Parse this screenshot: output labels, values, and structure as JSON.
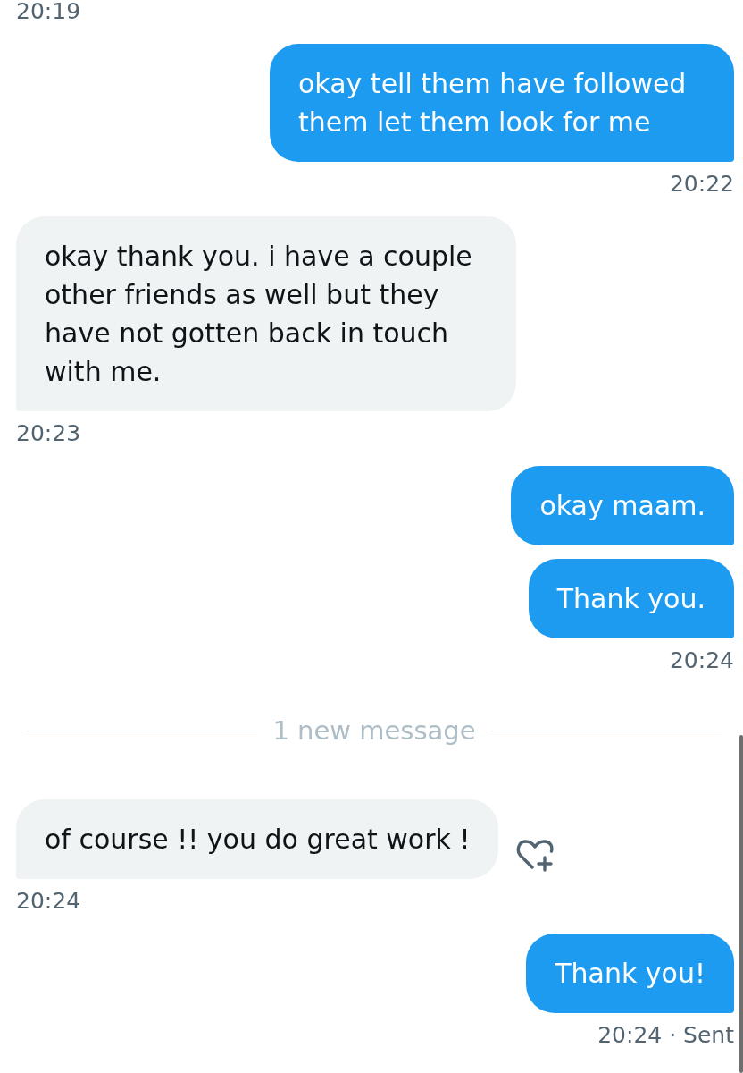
{
  "conversation": [
    {
      "kind": "time",
      "outgoing": false,
      "text": "20:19"
    },
    {
      "kind": "bubble",
      "outgoing": true,
      "text": "okay tell them have followed them let them look for me"
    },
    {
      "kind": "time",
      "outgoing": true,
      "text": "20:22"
    },
    {
      "kind": "bubble",
      "outgoing": false,
      "text": "okay thank you. i have a couple other friends as well but they have not gotten back in touch with me."
    },
    {
      "kind": "time",
      "outgoing": false,
      "text": "20:23"
    },
    {
      "kind": "bubble",
      "outgoing": true,
      "text": "okay maam."
    },
    {
      "kind": "bubble",
      "outgoing": true,
      "text": "Thank you."
    },
    {
      "kind": "time",
      "outgoing": true,
      "text": "20:24"
    },
    {
      "kind": "divider",
      "text": "1 new message"
    },
    {
      "kind": "bubble",
      "outgoing": false,
      "text": "of course !! you do great work !",
      "reaction_button": true
    },
    {
      "kind": "time",
      "outgoing": false,
      "text": "20:24"
    },
    {
      "kind": "bubble",
      "outgoing": true,
      "text": "Thank you!"
    },
    {
      "kind": "time",
      "outgoing": true,
      "text": "20:24 · Sent"
    }
  ]
}
